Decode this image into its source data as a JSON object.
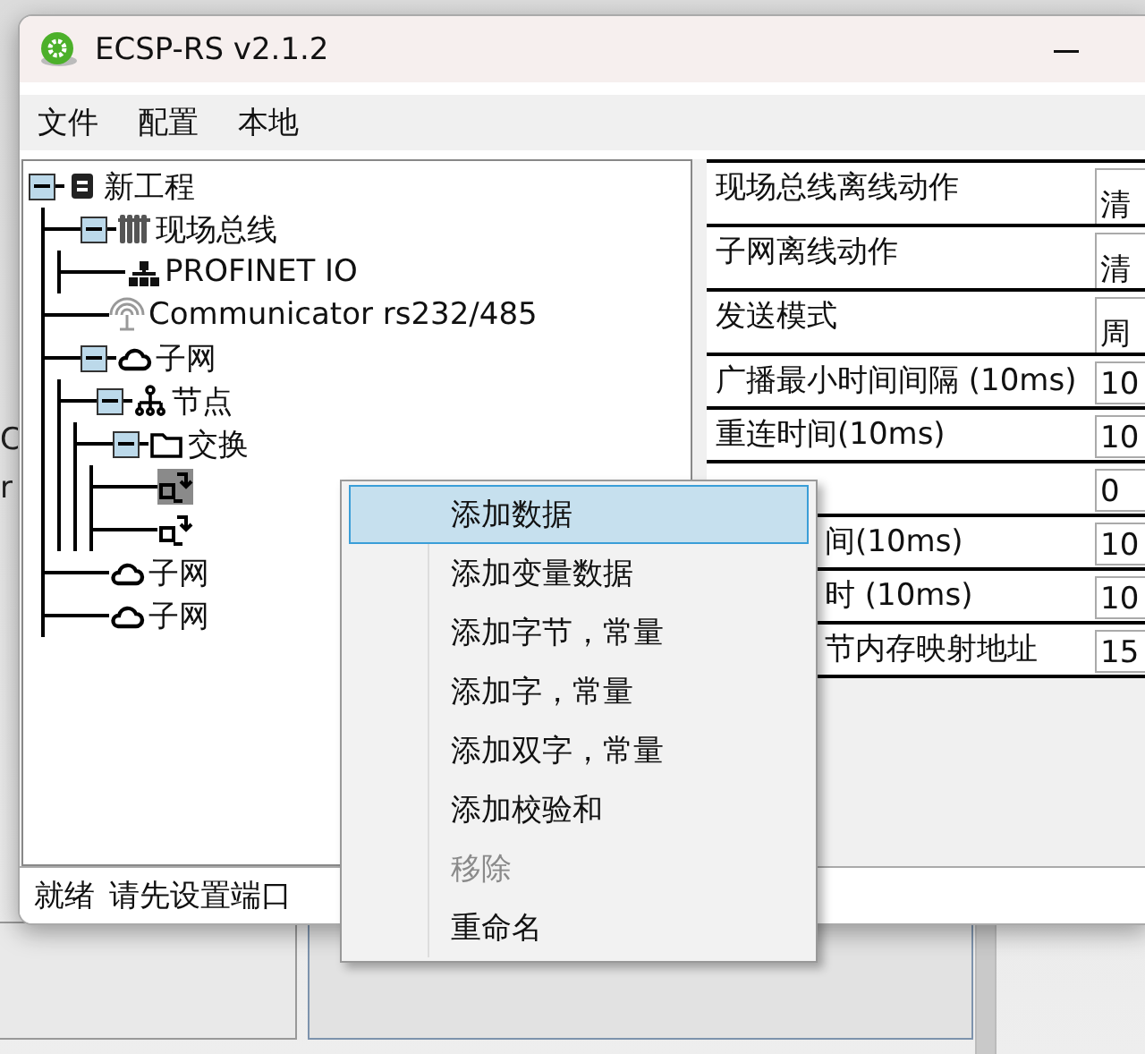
{
  "window": {
    "title": "ECSP-RS v2.1.2"
  },
  "menu_bar": [
    "文件",
    "配置",
    "本地"
  ],
  "tree": [
    {
      "label": "新工程",
      "kind": "project",
      "expanded": true,
      "selected": false,
      "children": [
        {
          "label": "现场总线",
          "kind": "bus",
          "expanded": true,
          "selected": false,
          "children": [
            {
              "label": "PROFINET IO",
              "kind": "network",
              "selected": false
            }
          ]
        },
        {
          "label": "Communicator rs232/485",
          "kind": "antenna",
          "selected": false
        },
        {
          "label": "子网",
          "kind": "cloud",
          "expanded": true,
          "selected": false,
          "children": [
            {
              "label": "节点",
              "kind": "hierarchy",
              "expanded": true,
              "selected": false,
              "children": [
                {
                  "label": "交换",
                  "kind": "folder",
                  "expanded": true,
                  "selected": false,
                  "children": [
                    {
                      "kind": "swap",
                      "selected": true
                    },
                    {
                      "kind": "swap",
                      "selected": false
                    }
                  ]
                }
              ]
            }
          ]
        },
        {
          "label": "子网",
          "kind": "cloud",
          "selected": false
        },
        {
          "label": "子网",
          "kind": "cloud",
          "selected": false
        }
      ]
    }
  ],
  "properties": [
    {
      "kind": "select",
      "label": "现场总线离线动作",
      "value": "清"
    },
    {
      "kind": "select",
      "label": "子网离线动作",
      "value": "清"
    },
    {
      "kind": "select",
      "label": "发送模式",
      "value": "周"
    },
    {
      "kind": "input",
      "label": "广播最小时间间隔 (10ms)",
      "value": "10"
    },
    {
      "kind": "input",
      "label": "重连时间(10ms)",
      "value": "10"
    },
    {
      "kind": "input",
      "value": "0"
    },
    {
      "kind": "input",
      "label": "间(10ms)",
      "covered": true,
      "value": "10"
    },
    {
      "kind": "input",
      "label": "时 (10ms)",
      "covered": true,
      "value": "10"
    },
    {
      "kind": "input",
      "label": "节内存映射地址",
      "covered": true,
      "value": "15"
    }
  ],
  "status_bar": [
    "就绪",
    "请先设置端口"
  ],
  "context_menu": [
    {
      "label": "添加数据",
      "selected": true,
      "disabled": false
    },
    {
      "label": "添加变量数据",
      "selected": false,
      "disabled": false
    },
    {
      "label": "添加字节，常量",
      "selected": false,
      "disabled": false
    },
    {
      "label": "添加字，常量",
      "selected": false,
      "disabled": false
    },
    {
      "label": "添加双字，常量",
      "selected": false,
      "disabled": false
    },
    {
      "label": "添加校验和",
      "selected": false,
      "disabled": false
    },
    {
      "label": "移除",
      "selected": false,
      "disabled": true
    },
    {
      "label": "重命名",
      "selected": false,
      "disabled": false
    }
  ],
  "background_window_text": [
    "C",
    "r"
  ]
}
